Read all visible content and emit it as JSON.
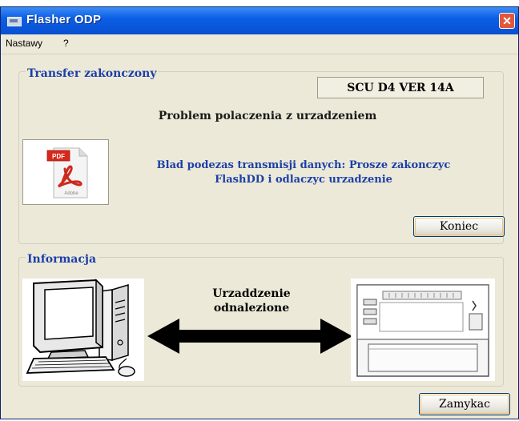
{
  "window": {
    "title": "Flasher ODP",
    "close_glyph": "✕"
  },
  "menu": {
    "items": [
      {
        "label": "Nastawy"
      },
      {
        "label": "?"
      }
    ]
  },
  "transfer": {
    "title": "Transfer zakonczony",
    "version": "SCU D4 VER  14A",
    "problem": "Problem polaczenia z urzadzeniem",
    "error_line1": "Blad podezas transmisji danych: Prosze zakonczyc",
    "error_line2": "FlashDD i odlaczyc urzadzenie",
    "end_button": "Koniec",
    "document_icon": "pdf-document-icon"
  },
  "info": {
    "title": "Informacja",
    "found_line1": "Urzaddzenie",
    "found_line2": "odnalezione",
    "computer_icon": "computer-icon",
    "device_icon": "device-icon"
  },
  "footer": {
    "close_button": "Zamykac"
  },
  "colors": {
    "title_blue": "#1c3fa8",
    "window_bg": "#ece9d8",
    "titlebar": "#0b5fe6",
    "close_red": "#e2563c"
  }
}
